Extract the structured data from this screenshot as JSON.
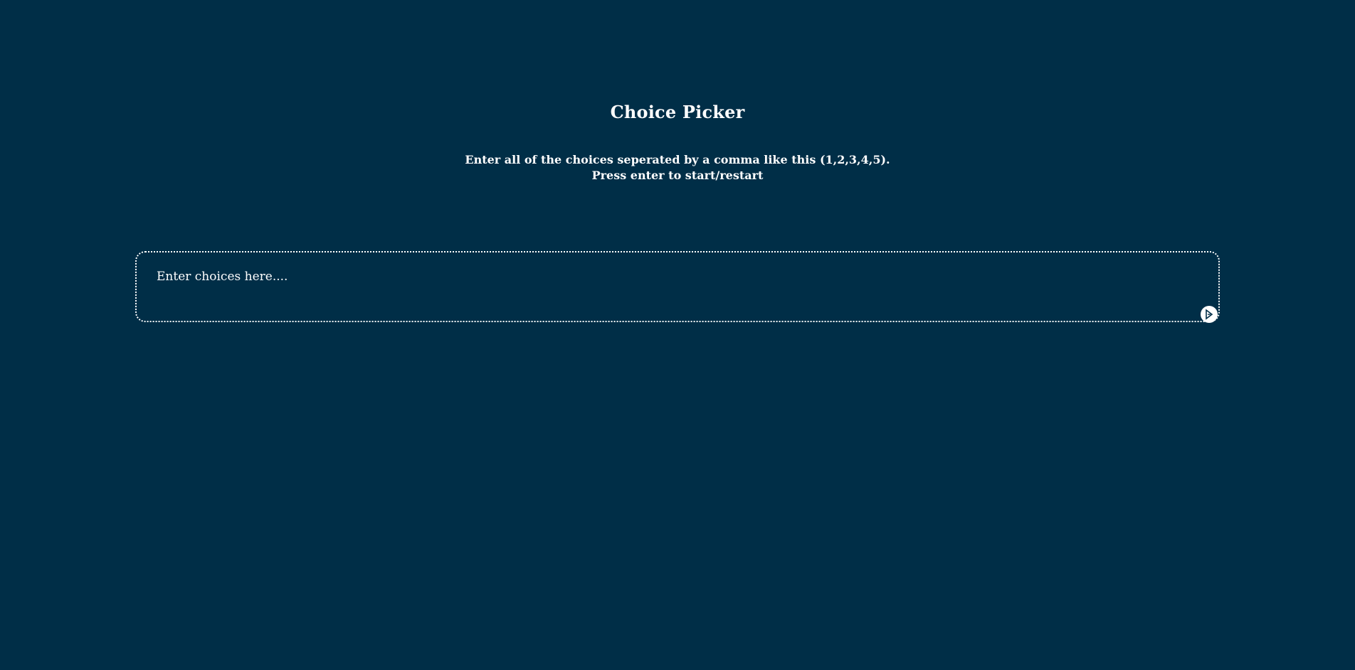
{
  "page": {
    "title": "Choice Picker",
    "instructions": {
      "line1": "Enter all of the choices seperated by a comma like this (1,2,3,4,5).",
      "line2": "Press enter to start/restart"
    }
  },
  "choices_input": {
    "placeholder": "Enter choices here....",
    "value": ""
  },
  "resize_handle": {
    "icon": "resize-grip-icon"
  },
  "colors": {
    "background": "#002e47",
    "text": "#ffffff",
    "border": "#ffffff"
  }
}
